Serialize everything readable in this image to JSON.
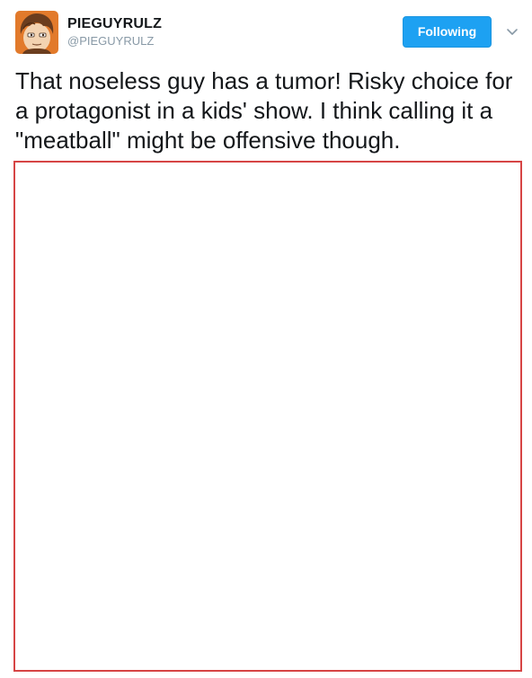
{
  "user": {
    "display_name": "PIEGUYRULZ",
    "handle": "@PIEGUYRULZ"
  },
  "follow_button": {
    "label": "Following"
  },
  "tweet": {
    "text": "That noseless guy has a tumor! Risky choice for a protagonist in a kids' show. I think calling it a \"meatball\" might be offensive though."
  },
  "icons": {
    "avatar": "cartoon-avatar-icon",
    "menu": "chevron-down-icon"
  },
  "colors": {
    "follow_button_bg": "#1da1f2",
    "handle_text": "#8899a6",
    "media_border": "#d64545",
    "body_text": "#14171a"
  }
}
